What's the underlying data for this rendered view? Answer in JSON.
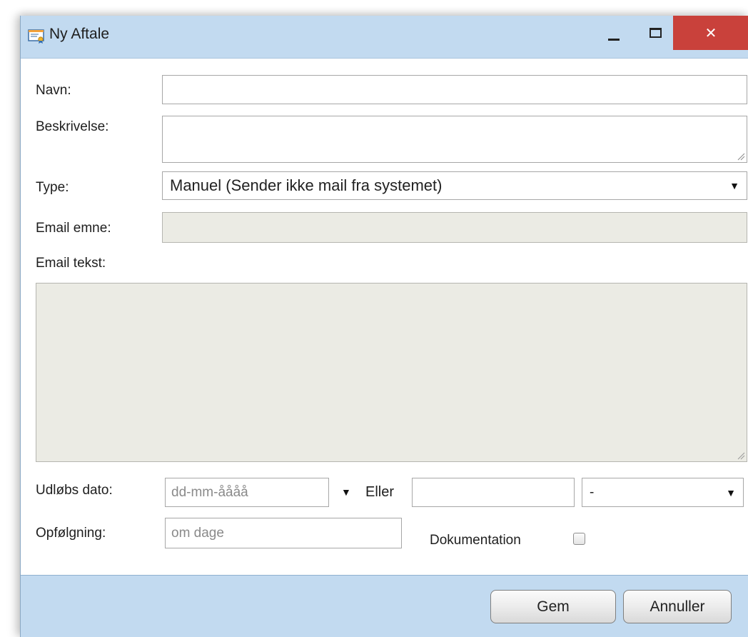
{
  "window": {
    "title": "Ny Aftale",
    "icon": "certificate-icon",
    "minimize_icon": "minimize-icon",
    "maximize_icon": "maximize-icon",
    "close_icon": "close-icon",
    "close_glyph": "✕"
  },
  "form": {
    "name": {
      "label": "Navn:",
      "value": ""
    },
    "description": {
      "label": "Beskrivelse:",
      "value": ""
    },
    "type": {
      "label": "Type:",
      "selected": "Manuel (Sender ikke mail fra systemet)",
      "caret": "▼"
    },
    "email_subject": {
      "label": "Email emne:",
      "value": ""
    },
    "email_text": {
      "label": "Email tekst:",
      "value": ""
    },
    "expiry": {
      "label": "Udløbs dato:",
      "date_placeholder": "dd-mm-åååå",
      "date_caret": "▼",
      "or_label": "Eller",
      "alt_value": "",
      "select_value": "-",
      "select_caret": "▼"
    },
    "followup": {
      "label": "Opfølgning:",
      "placeholder": "om dage"
    },
    "documentation": {
      "label": "Dokumentation",
      "checked": false
    }
  },
  "footer": {
    "save_label": "Gem",
    "cancel_label": "Annuller"
  },
  "colors": {
    "titlebar": "#c2daf0",
    "close_button": "#c9413b",
    "disabled_field": "#ebebe4"
  }
}
